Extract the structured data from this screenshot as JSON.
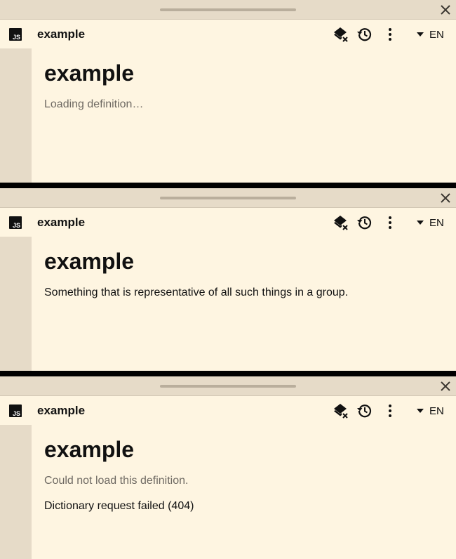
{
  "panels": [
    {
      "app_icon_text": "JS",
      "toolbar_title": "example",
      "language": "EN",
      "headword": "example",
      "status": "Loading definition…",
      "definition": "",
      "error_detail": ""
    },
    {
      "app_icon_text": "JS",
      "toolbar_title": "example",
      "language": "EN",
      "headword": "example",
      "status": "",
      "definition": "Something that is representative of all such things in a group.",
      "error_detail": ""
    },
    {
      "app_icon_text": "JS",
      "toolbar_title": "example",
      "language": "EN",
      "headword": "example",
      "status": "Could not load this definition.",
      "definition": "",
      "error_detail": "Dictionary request failed (404)"
    }
  ],
  "icons": {
    "close": "close-icon",
    "layers_clear": "layers-clear-icon",
    "history": "history-icon",
    "more": "more-vert-icon",
    "dropdown": "caret-down-icon"
  },
  "colors": {
    "panel_bg": "#fef5e1",
    "chrome_bg": "#e6dbc8",
    "separator": "#000000",
    "muted_text": "#6f6a63"
  }
}
